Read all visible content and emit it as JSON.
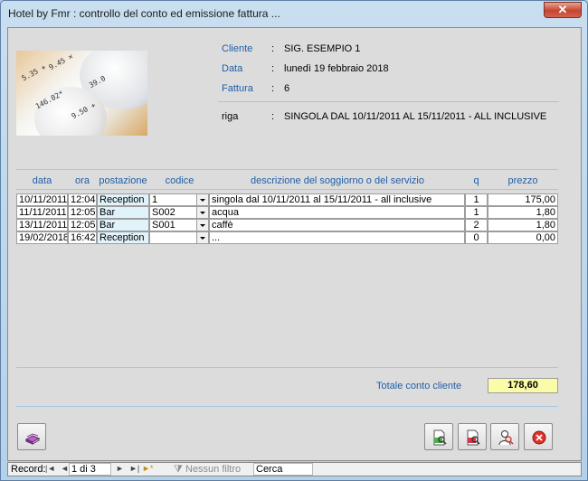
{
  "window": {
    "title": "Hotel by Fmr : controllo del conto ed emissione fattura ...",
    "close_glyph": "✕"
  },
  "header": {
    "fields": [
      {
        "label": "Cliente",
        "value": "SIG. ESEMPIO 1"
      },
      {
        "label": "Data",
        "value": "lunedì 19 febbraio 2018"
      },
      {
        "label": "Fattura",
        "value": "6"
      },
      {
        "label": "riga",
        "value": "SINGOLA DAL 10/11/2011 AL 15/11/2011 - ALL INCLUSIVE"
      }
    ],
    "colon": ":"
  },
  "photo": {
    "icon": "receipt-roll-photo",
    "digits": [
      "9.45 ×",
      "146.02*",
      "39.0",
      "9.50 +",
      "5.35 +"
    ]
  },
  "table": {
    "columns": [
      "data",
      "ora",
      "postazione",
      "codice",
      "descrizione del soggiorno o del servizio",
      "q",
      "prezzo"
    ],
    "rows": [
      {
        "data": "10/11/2011",
        "ora": "12:04",
        "postazione": "Reception",
        "codice": "1",
        "descrizione": "singola dal 10/11/2011 al 15/11/2011 - all inclusive",
        "q": "1",
        "prezzo": "175,00"
      },
      {
        "data": "11/11/2011",
        "ora": "12:05",
        "postazione": "Bar",
        "codice": "S002",
        "descrizione": "acqua",
        "q": "1",
        "prezzo": "1,80"
      },
      {
        "data": "13/11/2011",
        "ora": "12:05",
        "postazione": "Bar",
        "codice": "S001",
        "descrizione": "caffè",
        "q": "2",
        "prezzo": "1,80"
      },
      {
        "data": "19/02/2018",
        "ora": "16:42",
        "postazione": "Reception",
        "codice": "",
        "descrizione": "...",
        "q": "0",
        "prezzo": "0,00"
      }
    ]
  },
  "totals": {
    "label": "Totale conto cliente",
    "value": "178,60"
  },
  "buttons": {
    "left": [
      {
        "icon": "book-icon"
      }
    ],
    "right": [
      {
        "icon": "preview-report-icon"
      },
      {
        "icon": "print-report-icon"
      },
      {
        "icon": "person-search-icon"
      },
      {
        "icon": "close-circle-icon"
      }
    ]
  },
  "navbar": {
    "record_label": "Record:",
    "first": "|◄",
    "prev": "◄",
    "position": "1 di 3",
    "next": "►",
    "last": "►|",
    "new": "►*",
    "filter_label": "Nessun filtro",
    "search": "Cerca"
  },
  "colors": {
    "label_blue": "#1f5ea8",
    "total_bg": "#fbfca8",
    "postazione_bg": "#e0f3fb"
  }
}
